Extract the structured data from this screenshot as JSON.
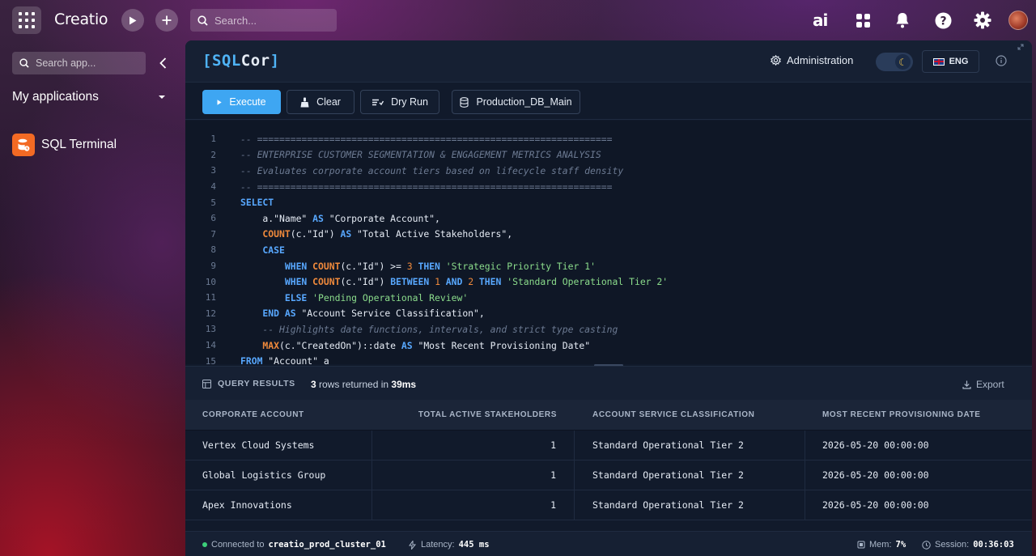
{
  "topbar": {
    "logo": "Creatio",
    "search_placeholder": "Search..."
  },
  "sidebar": {
    "search_placeholder": "Search app...",
    "section_title": "My applications",
    "apps": [
      {
        "label": "SQL Terminal"
      }
    ]
  },
  "panel": {
    "brand_open": "[SQL",
    "brand_cor": "Cor",
    "brand_close": "]",
    "admin_label": "Administration",
    "lang_label": "ENG"
  },
  "toolbar": {
    "execute_label": "Execute",
    "clear_label": "Clear",
    "dryrun_label": "Dry Run",
    "db_label": "Production_DB_Main"
  },
  "editor": {
    "lines": [
      {
        "num": "1"
      },
      {
        "num": "2"
      },
      {
        "num": "3"
      },
      {
        "num": "4"
      },
      {
        "num": "5"
      },
      {
        "num": "6"
      },
      {
        "num": "7"
      },
      {
        "num": "8"
      },
      {
        "num": "9"
      },
      {
        "num": "10"
      },
      {
        "num": "11"
      },
      {
        "num": "12"
      },
      {
        "num": "13"
      },
      {
        "num": "14"
      },
      {
        "num": "15"
      }
    ],
    "code": {
      "l1": "-- ================================================================",
      "l2": "-- ENTERPRISE CUSTOMER SEGMENTATION & ENGAGEMENT METRICS ANALYSIS",
      "l3": "-- Evaluates corporate account tiers based on lifecycle staff density",
      "l4": "-- ================================================================",
      "l5_kw": "SELECT",
      "l6_a": "    a.\"Name\" ",
      "l6_kw": "AS",
      "l6_b": " \"Corporate Account\",",
      "l7_fn": "    COUNT",
      "l7_a": "(c.\"Id\") ",
      "l7_kw": "AS",
      "l7_b": " \"Total Active Stakeholders\",",
      "l8_kw": "    CASE",
      "l9_kw1": "        WHEN ",
      "l9_fn": "COUNT",
      "l9_a": "(c.\"Id\") >= ",
      "l9_num": "3",
      "l9_kw2": " THEN ",
      "l9_str": "'Strategic Priority Tier 1'",
      "l10_kw1": "        WHEN ",
      "l10_fn": "COUNT",
      "l10_a": "(c.\"Id\") ",
      "l10_kw2": "BETWEEN ",
      "l10_num1": "1",
      "l10_kw3": " AND ",
      "l10_num2": "2",
      "l10_kw4": " THEN ",
      "l10_str": "'Standard Operational Tier 2'",
      "l11_kw": "        ELSE ",
      "l11_str": "'Pending Operational Review'",
      "l12_kw1": "    END ",
      "l12_kw2": "AS",
      "l12_b": " \"Account Service Classification\",",
      "l13": "    -- Highlights date functions, intervals, and strict type casting",
      "l14_fn": "    MAX",
      "l14_a": "(c.\"CreatedOn\")::date ",
      "l14_kw": "AS",
      "l14_b": " \"Most Recent Provisioning Date\"",
      "l15_kw": "FROM",
      "l15_b": " \"Account\" a"
    }
  },
  "results": {
    "title": "QUERY RESULTS",
    "row_count": "3",
    "rows_text": " rows returned in ",
    "duration": "39ms",
    "export_label": "Export",
    "columns": [
      "CORPORATE ACCOUNT",
      "TOTAL ACTIVE STAKEHOLDERS",
      "ACCOUNT SERVICE CLASSIFICATION",
      "MOST RECENT PROVISIONING DATE"
    ],
    "rows": [
      [
        "Vertex Cloud Systems",
        "1",
        "Standard Operational Tier 2",
        "2026-05-20 00:00:00"
      ],
      [
        "Global Logistics Group",
        "1",
        "Standard Operational Tier 2",
        "2026-05-20 00:00:00"
      ],
      [
        "Apex Innovations",
        "1",
        "Standard Operational Tier 2",
        "2026-05-20 00:00:00"
      ]
    ]
  },
  "status": {
    "connected_label": "Connected to",
    "cluster": "creatio_prod_cluster_01",
    "latency_label": "Latency:",
    "latency_value": "445 ms",
    "mem_label": "Mem:",
    "mem_value": "7%",
    "session_label": "Session:",
    "session_value": "00:36:03"
  },
  "colors": {
    "accent": "#3ea6f2",
    "keyword": "#58a8ff",
    "function": "#f08a3c",
    "string": "#8bdc8b",
    "status_ok": "#3ccf7a",
    "app_icon": "#f36a24"
  }
}
